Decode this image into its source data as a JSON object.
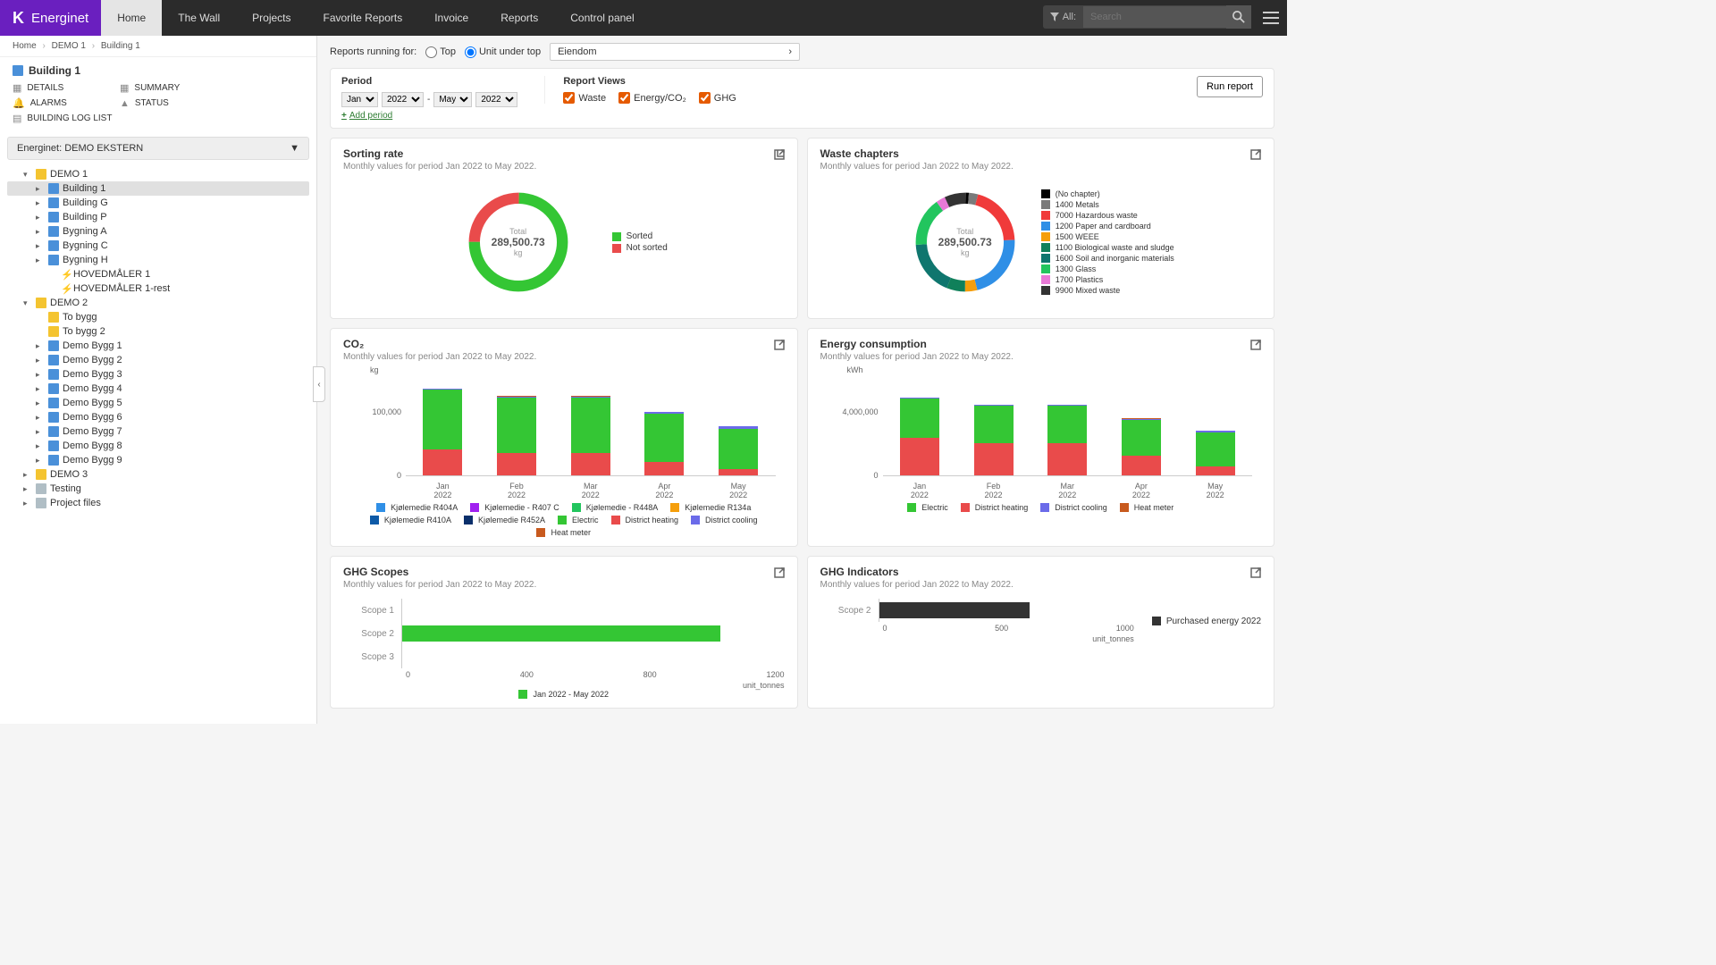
{
  "brand": "Energinet",
  "nav": {
    "items": [
      "Home",
      "The Wall",
      "Projects",
      "Favorite Reports",
      "Invoice",
      "Reports",
      "Control panel"
    ],
    "active": 0
  },
  "search": {
    "scope": "All:",
    "placeholder": "Search"
  },
  "breadcrumb": [
    "Home",
    "DEMO 1",
    "Building 1"
  ],
  "building": {
    "title": "Building 1",
    "links": [
      "DETAILS",
      "SUMMARY",
      "ALARMS",
      "STATUS",
      "BUILDING LOG LIST"
    ]
  },
  "tree_header": "Energinet: DEMO EKSTERN",
  "tree": [
    {
      "l": "DEMO 1",
      "icon": "folder",
      "ind": 1,
      "exp": true,
      "children": [
        {
          "l": "Building 1",
          "icon": "build",
          "ind": 2,
          "sel": true
        },
        {
          "l": "Building G",
          "icon": "build",
          "ind": 2
        },
        {
          "l": "Building P",
          "icon": "build",
          "ind": 2
        },
        {
          "l": "Bygning A",
          "icon": "build",
          "ind": 2
        },
        {
          "l": "Bygning C",
          "icon": "build",
          "ind": 2
        },
        {
          "l": "Bygning H",
          "icon": "build",
          "ind": 2
        },
        {
          "l": "HOVEDMÅLER 1",
          "icon": "bolt",
          "ind": 3,
          "leaf": true
        },
        {
          "l": "HOVEDMÅLER 1-rest",
          "icon": "bolt",
          "ind": 3,
          "leaf": true
        }
      ]
    },
    {
      "l": "DEMO 2",
      "icon": "folder",
      "ind": 1,
      "exp": true,
      "children": [
        {
          "l": "To bygg",
          "icon": "folder",
          "ind": 2,
          "leaf": true
        },
        {
          "l": "To bygg 2",
          "icon": "folder",
          "ind": 2,
          "leaf": true
        },
        {
          "l": "Demo Bygg 1",
          "icon": "build",
          "ind": 2
        },
        {
          "l": "Demo Bygg 2",
          "icon": "build",
          "ind": 2
        },
        {
          "l": "Demo Bygg 3",
          "icon": "build",
          "ind": 2
        },
        {
          "l": "Demo Bygg 4",
          "icon": "build",
          "ind": 2
        },
        {
          "l": "Demo Bygg 5",
          "icon": "build",
          "ind": 2
        },
        {
          "l": "Demo Bygg 6",
          "icon": "build",
          "ind": 2
        },
        {
          "l": "Demo Bygg 7",
          "icon": "build",
          "ind": 2
        },
        {
          "l": "Demo Bygg 8",
          "icon": "build",
          "ind": 2
        },
        {
          "l": "Demo Bygg 9",
          "icon": "build",
          "ind": 2
        }
      ]
    },
    {
      "l": "DEMO 3",
      "icon": "folder",
      "ind": 1
    },
    {
      "l": "Testing",
      "icon": "proj",
      "ind": 1
    },
    {
      "l": "Project files",
      "icon": "proj",
      "ind": 1
    }
  ],
  "report_controls": {
    "running_for": "Reports running for:",
    "opt_top": "Top",
    "opt_under": "Unit under top",
    "unit_selected": "Eiendom",
    "period_hdr": "Period",
    "period": {
      "m1": "Jan",
      "y1": "2022",
      "m2": "May",
      "y2": "2022"
    },
    "add_period": "Add period",
    "views_hdr": "Report Views",
    "views": [
      "Waste",
      "Energy/CO₂",
      "GHG"
    ],
    "run": "Run report"
  },
  "cards": {
    "sorting": {
      "title": "Sorting rate",
      "sub": "Monthly values for period Jan 2022 to May 2022.",
      "total_lbl": "Total",
      "total": "289,500.73",
      "unit": "kg",
      "legend": [
        {
          "c": "#34c634",
          "l": "Sorted"
        },
        {
          "c": "#e94b4b",
          "l": "Not sorted"
        }
      ]
    },
    "waste": {
      "title": "Waste chapters",
      "sub": "Monthly values for period Jan 2022 to May 2022.",
      "total_lbl": "Total",
      "total": "289,500.73",
      "unit": "kg",
      "legend": [
        {
          "c": "#000000",
          "l": "(No chapter)"
        },
        {
          "c": "#7a7a7a",
          "l": "1400 Metals"
        },
        {
          "c": "#f03a3a",
          "l": "7000 Hazardous waste"
        },
        {
          "c": "#2f8fe6",
          "l": "1200 Paper and cardboard"
        },
        {
          "c": "#f59e0b",
          "l": "1500 WEEE"
        },
        {
          "c": "#10805a",
          "l": "1100 Biological waste and sludge"
        },
        {
          "c": "#0f766e",
          "l": "1600 Soil and inorganic materials"
        },
        {
          "c": "#22c55e",
          "l": "1300 Glass"
        },
        {
          "c": "#e879d6",
          "l": "1700 Plastics"
        },
        {
          "c": "#333333",
          "l": "9900 Mixed waste"
        }
      ]
    },
    "co2": {
      "title": "CO₂",
      "sub": "Monthly values for period Jan 2022 to May 2022.",
      "yunit": "kg",
      "legend": [
        {
          "c": "#2f8fe6",
          "l": "Kjølemedie R404A"
        },
        {
          "c": "#a020f0",
          "l": "Kjølemedie - R407 C"
        },
        {
          "c": "#22c55e",
          "l": "Kjølemedie - R448A"
        },
        {
          "c": "#f59e0b",
          "l": "Kjølemedie R134a"
        },
        {
          "c": "#0d5aa7",
          "l": "Kjølemedie R410A"
        },
        {
          "c": "#0a2f6b",
          "l": "Kjølemedie R452A"
        },
        {
          "c": "#34c634",
          "l": "Electric"
        },
        {
          "c": "#e94b4b",
          "l": "District heating"
        },
        {
          "c": "#6b6be9",
          "l": "District cooling"
        },
        {
          "c": "#c85a1e",
          "l": "Heat meter"
        }
      ]
    },
    "energy": {
      "title": "Energy consumption",
      "sub": "Monthly values for period Jan 2022 to May 2022.",
      "yunit": "kWh",
      "legend": [
        {
          "c": "#34c634",
          "l": "Electric"
        },
        {
          "c": "#e94b4b",
          "l": "District heating"
        },
        {
          "c": "#6b6be9",
          "l": "District cooling"
        },
        {
          "c": "#c85a1e",
          "l": "Heat meter"
        }
      ]
    },
    "scopes": {
      "title": "GHG Scopes",
      "sub": "Monthly values for period Jan 2022 to May 2022.",
      "rows": [
        "Scope 1",
        "Scope 2",
        "Scope 3"
      ],
      "xticks": [
        "0",
        "400",
        "800",
        "1200"
      ],
      "xunit": "unit_tonnes",
      "legend": [
        {
          "c": "#34c634",
          "l": "Jan 2022 - May 2022"
        }
      ]
    },
    "indicators": {
      "title": "GHG Indicators",
      "sub": "Monthly values for period Jan 2022 to May 2022.",
      "rows": [
        "Scope 2"
      ],
      "xticks": [
        "0",
        "500",
        "1000"
      ],
      "xunit": "unit_tonnes",
      "legend": [
        {
          "c": "#333333",
          "l": "Purchased energy 2022"
        }
      ]
    }
  },
  "chart_data": [
    {
      "type": "pie",
      "title": "Sorting rate",
      "total": 289500.73,
      "unit": "kg",
      "slices": [
        {
          "name": "Sorted",
          "pct": 75
        },
        {
          "name": "Not sorted",
          "pct": 25
        }
      ]
    },
    {
      "type": "pie",
      "title": "Waste chapters",
      "total": 289500.73,
      "unit": "kg",
      "slices": [
        {
          "name": "(No chapter)",
          "pct": 1
        },
        {
          "name": "1400 Metals",
          "pct": 3
        },
        {
          "name": "7000 Hazardous waste",
          "pct": 20
        },
        {
          "name": "1200 Paper and cardboard",
          "pct": 22
        },
        {
          "name": "1500 WEEE",
          "pct": 4
        },
        {
          "name": "1100 Biological waste and sludge",
          "pct": 6
        },
        {
          "name": "1600 Soil and inorganic materials",
          "pct": 18
        },
        {
          "name": "1300 Glass",
          "pct": 16
        },
        {
          "name": "1700 Plastics",
          "pct": 3
        },
        {
          "name": "9900 Mixed waste",
          "pct": 7
        }
      ]
    },
    {
      "type": "bar",
      "title": "CO₂",
      "ylabel": "kg",
      "ylim": [
        0,
        120000
      ],
      "ytick": 100000,
      "categories": [
        "Jan 2022",
        "Feb 2022",
        "Mar 2022",
        "Apr 2022",
        "May 2022"
      ],
      "series": [
        {
          "name": "District heating",
          "color": "#e94b4b",
          "values": [
            35000,
            30000,
            30000,
            18000,
            8000
          ]
        },
        {
          "name": "Electric",
          "color": "#34c634",
          "values": [
            80000,
            75000,
            75000,
            65000,
            55000
          ]
        },
        {
          "name": "District cooling",
          "color": "#6b6be9",
          "values": [
            1000,
            1000,
            1000,
            2000,
            3000
          ]
        },
        {
          "name": "Heat meter",
          "color": "#c85a1e",
          "values": [
            500,
            500,
            500,
            500,
            500
          ]
        }
      ]
    },
    {
      "type": "bar",
      "title": "Energy consumption",
      "ylabel": "kWh",
      "ylim": [
        0,
        5000000
      ],
      "ytick": 4000000,
      "categories": [
        "Jan 2022",
        "Feb 2022",
        "Mar 2022",
        "Apr 2022",
        "May 2022"
      ],
      "series": [
        {
          "name": "District heating",
          "color": "#e94b4b",
          "values": [
            2100000,
            1800000,
            1800000,
            1100000,
            500000
          ]
        },
        {
          "name": "Electric",
          "color": "#34c634",
          "values": [
            2200000,
            2100000,
            2100000,
            2000000,
            1900000
          ]
        },
        {
          "name": "District cooling",
          "color": "#6b6be9",
          "values": [
            40000,
            40000,
            40000,
            60000,
            80000
          ]
        },
        {
          "name": "Heat meter",
          "color": "#c85a1e",
          "values": [
            20000,
            20000,
            20000,
            20000,
            20000
          ]
        }
      ]
    },
    {
      "type": "bar",
      "title": "GHG Scopes",
      "orientation": "horizontal",
      "xlabel": "unit_tonnes",
      "xlim": [
        0,
        1200
      ],
      "categories": [
        "Scope 1",
        "Scope 2",
        "Scope 3"
      ],
      "series": [
        {
          "name": "Jan 2022 - May 2022",
          "color": "#34c634",
          "values": [
            0,
            1000,
            0
          ]
        }
      ]
    },
    {
      "type": "bar",
      "title": "GHG Indicators",
      "orientation": "horizontal",
      "xlabel": "unit_tonnes",
      "xlim": [
        0,
        1100
      ],
      "categories": [
        "Scope 2"
      ],
      "series": [
        {
          "name": "Purchased energy 2022",
          "color": "#333333",
          "values": [
            650
          ]
        }
      ]
    }
  ]
}
